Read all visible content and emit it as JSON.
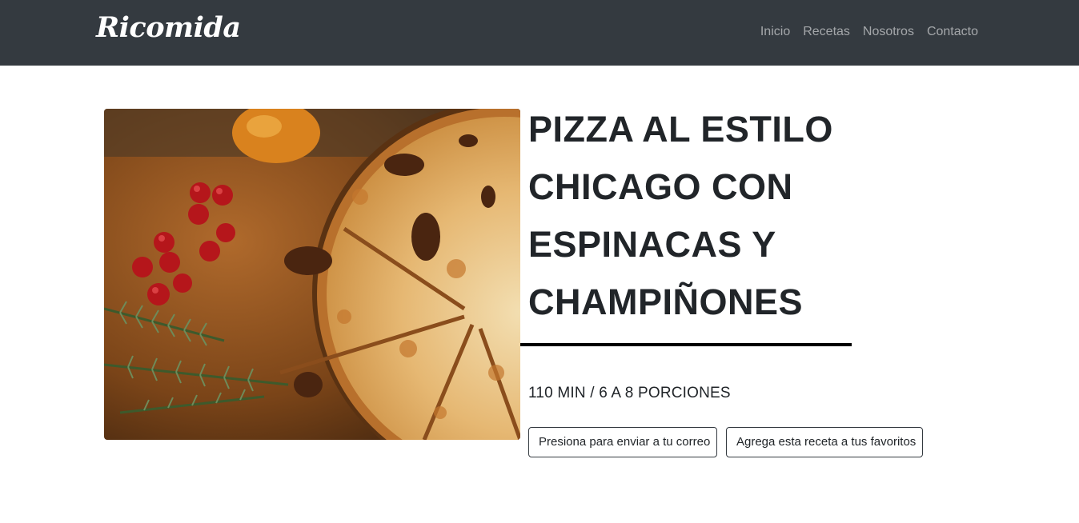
{
  "navbar": {
    "brand": "Ricomida",
    "links": [
      {
        "label": "Inicio"
      },
      {
        "label": "Recetas"
      },
      {
        "label": "Nosotros"
      },
      {
        "label": "Contacto"
      }
    ]
  },
  "recipe": {
    "title": "PIZZA AL ESTILO CHICAGO CON ESPINACAS Y CHAMPIÑONES",
    "meta": "110 MIN / 6 A 8 PORCIONES",
    "image": "pizza-photo"
  },
  "actions": {
    "email_label": "Presiona para enviar a tu correo",
    "favorite_label": "Agrega esta receta a tus favoritos"
  },
  "colors": {
    "navbar_bg": "#343a40",
    "rule": "#000000"
  }
}
